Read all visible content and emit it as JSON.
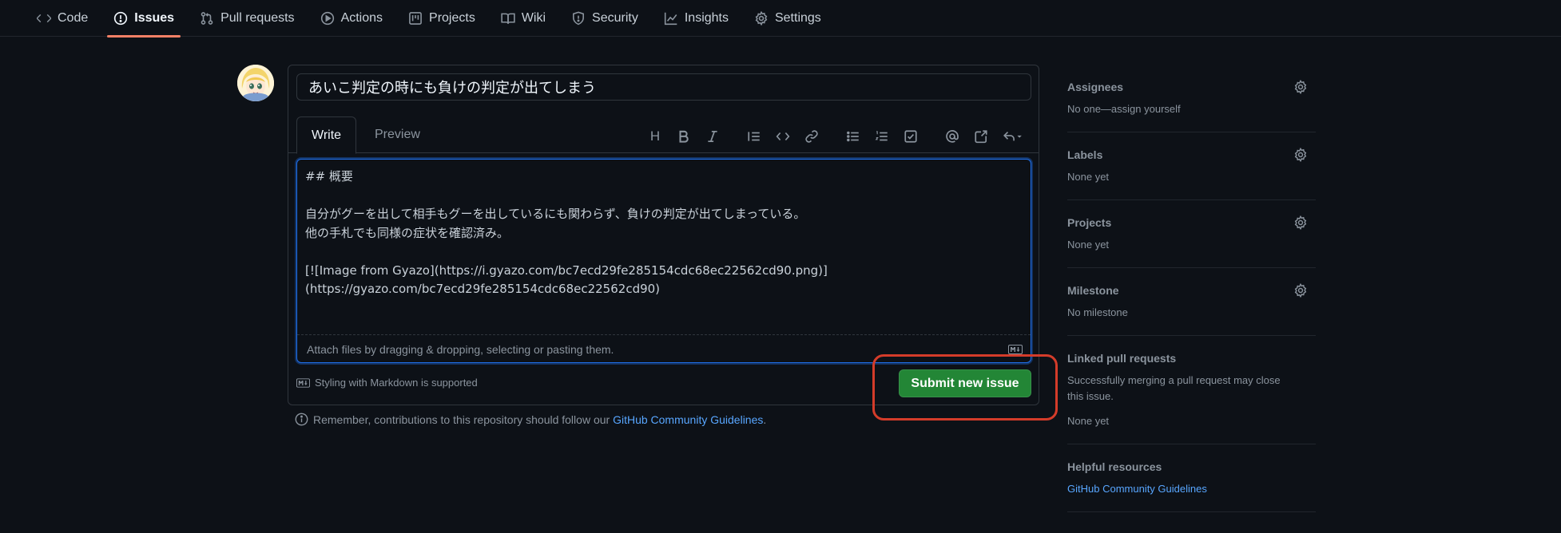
{
  "nav": {
    "items": [
      {
        "label": "Code",
        "icon": "code-icon"
      },
      {
        "label": "Issues",
        "icon": "issue-icon",
        "active": true
      },
      {
        "label": "Pull requests",
        "icon": "pull-request-icon"
      },
      {
        "label": "Actions",
        "icon": "play-icon"
      },
      {
        "label": "Projects",
        "icon": "project-icon"
      },
      {
        "label": "Wiki",
        "icon": "book-icon"
      },
      {
        "label": "Security",
        "icon": "shield-icon"
      },
      {
        "label": "Insights",
        "icon": "graph-icon"
      },
      {
        "label": "Settings",
        "icon": "gear-icon"
      }
    ],
    "active_color": "#f78166"
  },
  "issue": {
    "title": "あいこ判定の時にも負けの判定が出てしまう",
    "tabs": {
      "write": "Write",
      "preview": "Preview"
    },
    "toolbar": {
      "heading": "H"
    },
    "body": "## 概要\n\n自分がグーを出して相手もグーを出しているにも関わらず、負けの判定が出てしまっている。\n他の手札でも同様の症状を確認済み。\n\n[![Image from Gyazo](https://i.gyazo.com/bc7ecd29fe285154cdc68ec22562cd90.png)]\n(https://gyazo.com/bc7ecd29fe285154cdc68ec22562cd90)",
    "attach_hint": "Attach files by dragging & dropping, selecting or pasting them.",
    "markdown_hint": "Styling with Markdown is supported",
    "submit_label": "Submit new issue",
    "submit_color": "#238636"
  },
  "guidelines": {
    "prefix": "Remember, contributions to this repository should follow our ",
    "link": "GitHub Community Guidelines",
    "suffix": "."
  },
  "sidebar": {
    "assignees": {
      "title": "Assignees",
      "value": "No one—assign yourself"
    },
    "labels": {
      "title": "Labels",
      "value": "None yet"
    },
    "projects": {
      "title": "Projects",
      "value": "None yet"
    },
    "milestone": {
      "title": "Milestone",
      "value": "No milestone"
    },
    "linked_prs": {
      "title": "Linked pull requests",
      "description": "Successfully merging a pull request may close this issue.",
      "value": "None yet"
    },
    "resources": {
      "title": "Helpful resources",
      "link": "GitHub Community Guidelines"
    }
  },
  "colors": {
    "background": "#0d1117",
    "link": "#58a6ff",
    "highlight": "#d43c2a"
  }
}
